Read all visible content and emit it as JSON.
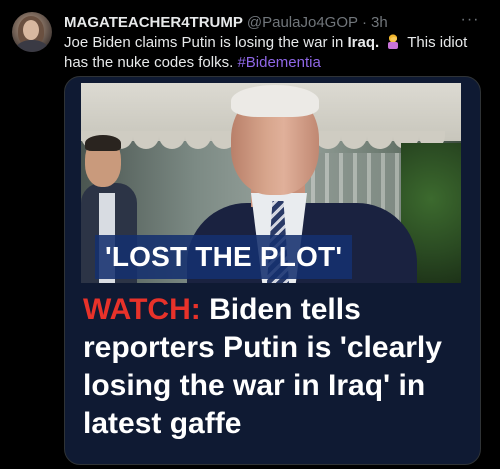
{
  "tweet": {
    "display_name": "MAGATEACHER4TRUMP",
    "handle": "@PaulaJo4GOP",
    "separator": "·",
    "timestamp": "3h",
    "more_glyph": "···",
    "text_part1": "Joe Biden claims Putin is losing the war in ",
    "text_bold": "Iraq.",
    "emoji": "facepalm-emoji",
    "text_part2": " This idiot has the nuke codes folks. ",
    "hashtag": "#Bidementia"
  },
  "media": {
    "lower_third": "'LOST THE PLOT'",
    "headline_prefix": "WATCH:",
    "headline_rest": " Biden tells reporters Putin is 'clearly losing the war in Iraq' in latest gaffe"
  },
  "colors": {
    "background": "#000000",
    "text": "#e7e9ea",
    "muted": "#71767b",
    "hashtag": "#8f67e6",
    "card_bg": "#0f1a33",
    "watch_red": "#e8322a",
    "lower_third_bg": "#14306e"
  }
}
